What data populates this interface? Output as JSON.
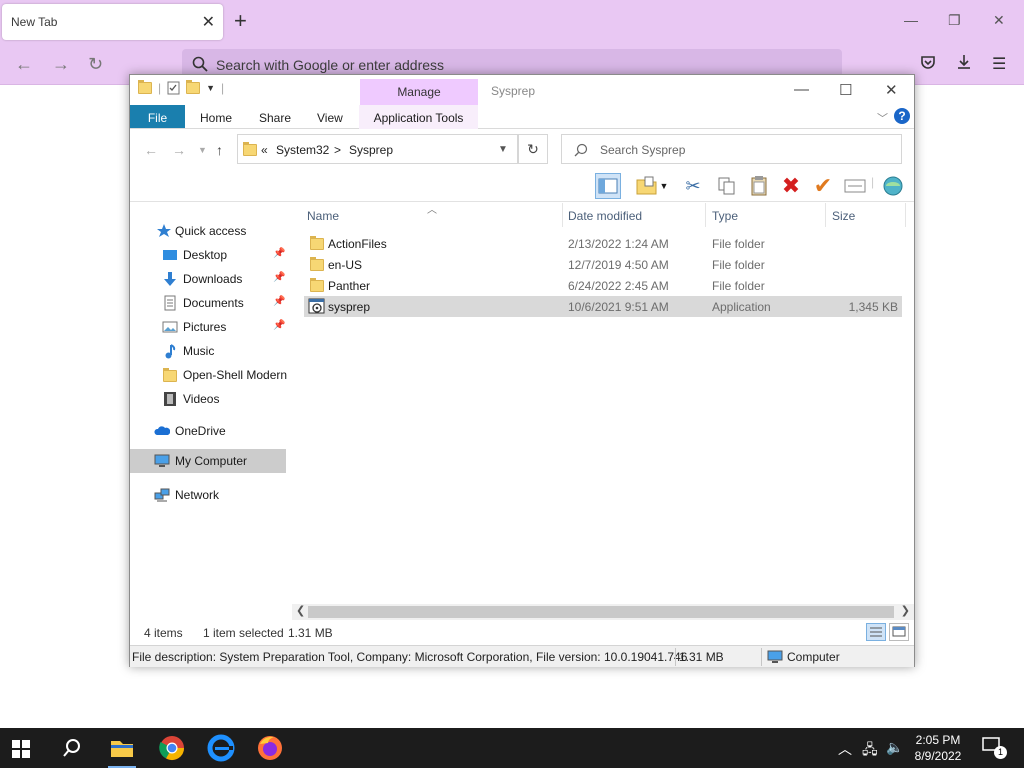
{
  "browser": {
    "tab_title": "New Tab",
    "tab_close": "✕",
    "new_tab": "+",
    "url_placeholder": "Search with Google or enter address"
  },
  "explorer": {
    "title": "Sysprep",
    "manage_tab": "Manage",
    "ribbon_tabs": {
      "file": "File",
      "home": "Home",
      "share": "Share",
      "view": "View",
      "app_tools": "Application Tools"
    },
    "address": {
      "chevron": "«",
      "seg1": "System32",
      "sep": ">",
      "seg2": "Sysprep"
    },
    "search_placeholder": "Search Sysprep",
    "nav": {
      "quick_access": "Quick access",
      "desktop": "Desktop",
      "downloads": "Downloads",
      "documents": "Documents",
      "pictures": "Pictures",
      "music": "Music",
      "openshell": "Open-Shell Modern",
      "videos": "Videos",
      "onedrive": "OneDrive",
      "mycomputer": "My Computer",
      "network": "Network"
    },
    "columns": {
      "name": "Name",
      "date": "Date modified",
      "type": "Type",
      "size": "Size"
    },
    "files": [
      {
        "name": "ActionFiles",
        "date": "2/13/2022 1:24 AM",
        "type": "File folder",
        "size": ""
      },
      {
        "name": "en-US",
        "date": "12/7/2019 4:50 AM",
        "type": "File folder",
        "size": ""
      },
      {
        "name": "Panther",
        "date": "6/24/2022 2:45 AM",
        "type": "File folder",
        "size": ""
      },
      {
        "name": "sysprep",
        "date": "10/6/2021 9:51 AM",
        "type": "Application",
        "size": "1,345 KB"
      }
    ],
    "status": {
      "items": "4 items",
      "selected": "1 item selected",
      "selected_size": "1.31 MB"
    },
    "description": {
      "text": "File description: System Preparation Tool, Company: Microsoft Corporation, File version: 10.0.19041.746",
      "size": "1.31 MB",
      "location": "Computer"
    }
  },
  "taskbar": {
    "time": "2:05 PM",
    "date": "8/9/2022",
    "notif_count": "1"
  },
  "colors": {
    "browser_bg": "#e9c8f3",
    "ribbon_file": "#1a7fae",
    "manage_tab": "#efcaff",
    "taskbar": "#1c1c1c"
  }
}
